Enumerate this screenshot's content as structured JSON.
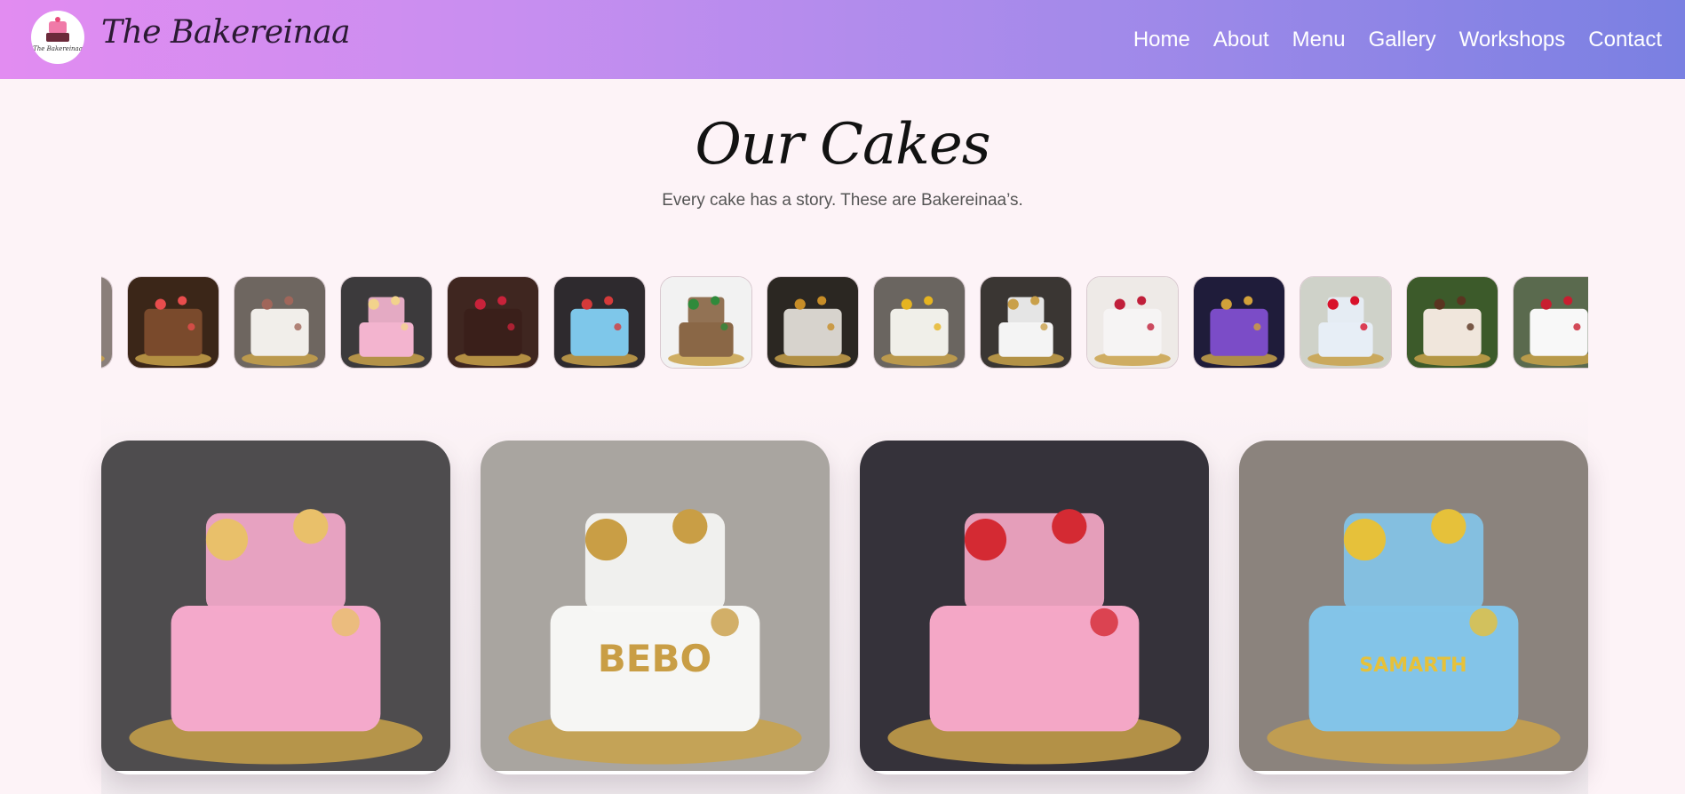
{
  "brand": {
    "name": "The Bakereinaa",
    "logo_text": "The Bakereinaa"
  },
  "nav": {
    "items": [
      {
        "label": "Home"
      },
      {
        "label": "About"
      },
      {
        "label": "Menu"
      },
      {
        "label": "Gallery"
      },
      {
        "label": "Workshops"
      },
      {
        "label": "Contact"
      }
    ]
  },
  "section": {
    "title": "Our Cakes",
    "subtitle": "Every cake has a story. These are Bakereinaa’s."
  },
  "gallery_strip": {
    "thumbnails": [
      {
        "icon": "cake-photo-icon",
        "bg": "#8a7f7a",
        "cake": "#e9e4e1",
        "accent": "#b07a6b"
      },
      {
        "icon": "chocolate-box-photo-icon",
        "bg": "#3b2618",
        "cake": "#7a4a2c",
        "accent": "#e94d4d"
      },
      {
        "icon": "cake-photo-icon",
        "bg": "#6e6660",
        "cake": "#f1eeea",
        "accent": "#a0665a"
      },
      {
        "icon": "cake-photo-icon",
        "bg": "#3c3a3c",
        "cake": "#f3b4cf",
        "accent": "#f2d38c"
      },
      {
        "icon": "cake-photo-icon",
        "bg": "#3f2620",
        "cake": "#3a1f1a",
        "accent": "#c8223a"
      },
      {
        "icon": "cake-photo-icon",
        "bg": "#2e2a2e",
        "cake": "#7ec7ea",
        "accent": "#d43a3a"
      },
      {
        "icon": "cake-photo-icon",
        "bg": "#f2f2f2",
        "cake": "#8a6746",
        "accent": "#2f8a3b"
      },
      {
        "icon": "cake-photo-icon",
        "bg": "#2b2722",
        "cake": "#d7d3cd",
        "accent": "#c78d27"
      },
      {
        "icon": "cake-photo-icon",
        "bg": "#6a6560",
        "cake": "#f0efe9",
        "accent": "#e6b420"
      },
      {
        "icon": "cake-photo-icon",
        "bg": "#3a3633",
        "cake": "#f4f4f4",
        "accent": "#c9a04a"
      },
      {
        "icon": "cake-photo-icon",
        "bg": "#eeeae7",
        "cake": "#f6f4f4",
        "accent": "#c01f3a"
      },
      {
        "icon": "cake-photo-icon",
        "bg": "#1f1c3a",
        "cake": "#7b4cc7",
        "accent": "#d2a13a"
      },
      {
        "icon": "cake-photo-icon",
        "bg": "#cfd2c9",
        "cake": "#e7eef6",
        "accent": "#d8112a"
      },
      {
        "icon": "cake-photo-icon",
        "bg": "#3c5a2a",
        "cake": "#f0e6dc",
        "accent": "#5a3520"
      },
      {
        "icon": "cake-photo-icon",
        "bg": "#5a6a4e",
        "cake": "#f8f8f8",
        "accent": "#c81e30"
      }
    ]
  },
  "cards": [
    {
      "icon": "donut-drip-cake-photo-icon",
      "bg": "#4e4c4e",
      "cake": "#f4a9cb",
      "accent": "#e9c06a",
      "text": ""
    },
    {
      "icon": "money-birthday-cake-photo-icon",
      "bg": "#a9a5a0",
      "cake": "#f6f6f4",
      "accent": "#c99e45",
      "text": "BEBO"
    },
    {
      "icon": "fashion-cake-photo-icon",
      "bg": "#35323a",
      "cake": "#f4a7c6",
      "accent": "#d42a33",
      "text": ""
    },
    {
      "icon": "balloon-birthday-cake-photo-icon",
      "bg": "#8b837d",
      "cake": "#83c4e8",
      "accent": "#e6c13a",
      "text": "SAMARTH"
    }
  ]
}
